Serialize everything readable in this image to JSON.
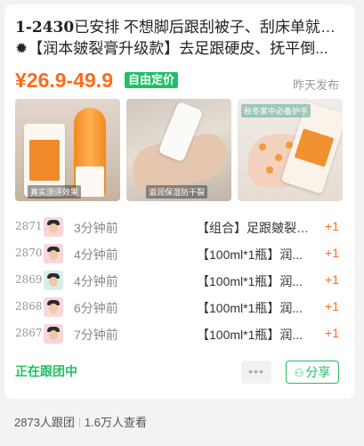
{
  "listing": {
    "title_num": "1-2430",
    "title_line1_text": "已安排 不想脚后跟刮被子、刮床单就用它",
    "title_line2": "✹【润本皴裂膏升级款】去足跟硬皮、抚平倒...",
    "price": "¥26.9-49.9",
    "price_badge": "自由定价",
    "posted": "昨天发布",
    "photo_captions": [
      "真实测评效果",
      "滋润保湿防干裂",
      "秋冬家中必备护手"
    ]
  },
  "feed": [
    {
      "seq": "2871",
      "time": "3分钟前",
      "item": "【组合】足跟皴裂膏...",
      "qty": "+1"
    },
    {
      "seq": "2870",
      "time": "4分钟前",
      "item": "【100ml*1瓶】润...",
      "qty": "+1"
    },
    {
      "seq": "2869",
      "time": "4分钟前",
      "item": "【100ml*1瓶】润...",
      "qty": "+1"
    },
    {
      "seq": "2868",
      "time": "6分钟前",
      "item": "【100ml*1瓶】润...",
      "qty": "+1"
    },
    {
      "seq": "2867",
      "time": "7分钟前",
      "item": "【100ml*1瓶】润...",
      "qty": "+1"
    }
  ],
  "actions": {
    "status": "正在跟团中",
    "more": "•••",
    "share_icon": "wechat-icon",
    "share": "分享"
  },
  "stats": {
    "joined": "2873人跟团",
    "views": "1.6万人查看"
  },
  "colors": {
    "accent_green": "#22c064",
    "price_orange": "#ff6a1a"
  }
}
